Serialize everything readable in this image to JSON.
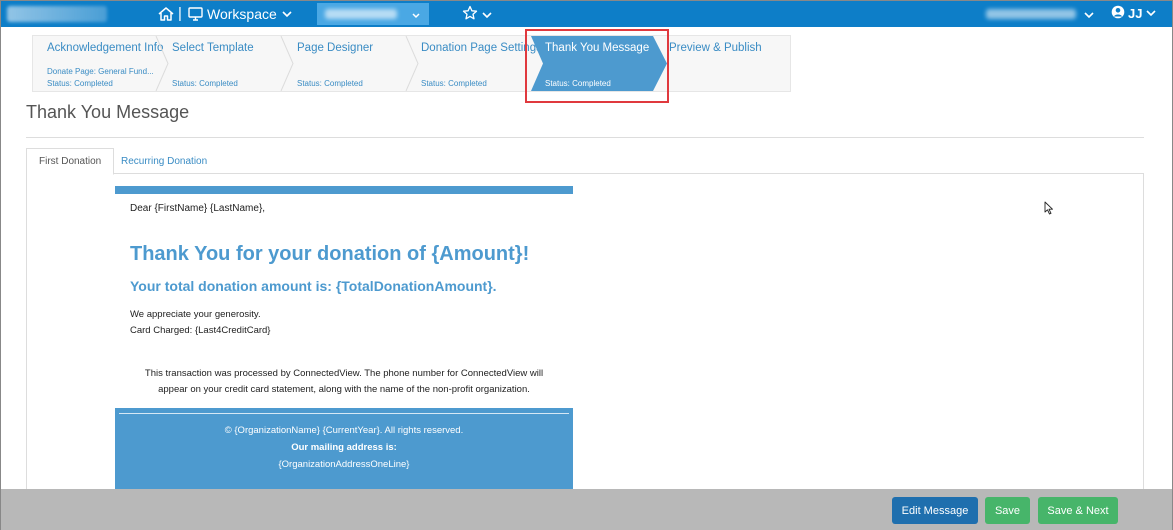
{
  "topbar": {
    "workspace_label": "Workspace",
    "separator": "|",
    "user_initials": "JJ"
  },
  "wizard": {
    "steps": [
      {
        "title": "Acknowledgement Info",
        "subtitle": "Donate Page: General Fund...",
        "status": "Status: Completed"
      },
      {
        "title": "Select Template",
        "status": "Status: Completed"
      },
      {
        "title": "Page Designer",
        "status": "Status: Completed"
      },
      {
        "title": "Donation Page Settings",
        "status": "Status: Completed"
      },
      {
        "title": "Thank You Message",
        "status": "Status: Completed"
      },
      {
        "title": "Preview & Publish"
      }
    ],
    "active_step": 4
  },
  "page": {
    "title": "Thank You Message"
  },
  "tabs": [
    {
      "label": "First Donation"
    },
    {
      "label": "Recurring Donation"
    }
  ],
  "email": {
    "greeting": "Dear {FirstName} {LastName},",
    "headline": "Thank You for your donation of {Amount}!",
    "subheadline": "Your total donation amount is: {TotalDonationAmount}.",
    "appreciate": "We appreciate your generosity.",
    "card_charged": "Card Charged: {Last4CreditCard}",
    "processed_line1": "This transaction was processed by ConnectedView. The phone number for ConnectedView will",
    "processed_line2": "appear on your credit card statement, along with the name of the non-profit organization.",
    "footer_copyright": "© {OrganizationName} {CurrentYear}. All rights reserved.",
    "footer_mailing_label": "Our mailing address is:",
    "footer_address": "{OrganizationAddressOneLine}"
  },
  "actions": {
    "edit_label": "Edit Message",
    "save_label": "Save",
    "save_next_label": "Save & Next"
  },
  "colors": {
    "topbar": "#0d7ec8",
    "accent": "#4d9acf",
    "active_step": "#4d9acf",
    "highlight": "#e0393e",
    "edit_button": "#1f6fae",
    "save_button": "#47b56a"
  }
}
